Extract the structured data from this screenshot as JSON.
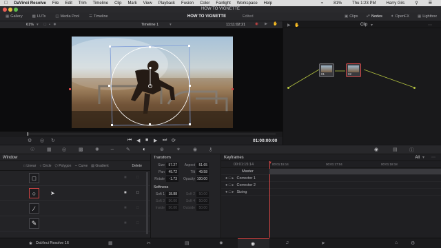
{
  "mac_menu": {
    "app": "DaVinci Resolve",
    "items": [
      "File",
      "Edit",
      "Trim",
      "Timeline",
      "Clip",
      "Mark",
      "View",
      "Playback",
      "Fusion",
      "Color",
      "Fairlight",
      "Workspace",
      "Help"
    ],
    "battery": "81%",
    "clock": "Thu 1:23 PM",
    "user": "Harry Gils"
  },
  "window_title": "HOW TO VIGNETTE",
  "top_toolbar": {
    "gallery": "Gallery",
    "luts": "LUTs",
    "media_pool": "Media Pool",
    "timeline": "Timeline",
    "project_title": "HOW TO VIGNETTE",
    "edited": "Edited",
    "clips": "Clips",
    "nodes": "Nodes",
    "openfx": "OpenFX",
    "lightbox": "Lightbox"
  },
  "viewer_bar": {
    "zoom": "61%",
    "timeline_name": "Timeline 1",
    "timecode": "11:11:02:21",
    "clip_label": "Clip"
  },
  "transport": {
    "timecode": "01:00:00:00"
  },
  "nodes": [
    {
      "label": "01"
    },
    {
      "label": "02"
    }
  ],
  "window_panel": {
    "title": "Window",
    "tools": [
      "Linear",
      "Circle",
      "Polygon",
      "Curve",
      "Gradient"
    ],
    "delete": "Delete"
  },
  "transform": {
    "title": "Transform",
    "rows": [
      {
        "l1": "Size",
        "v1": "57.27",
        "l2": "Aspect",
        "v2": "51.65"
      },
      {
        "l1": "Pan",
        "v1": "49.72",
        "l2": "Tilt",
        "v2": "49.58"
      },
      {
        "l1": "Rotate",
        "v1": "-1.73",
        "l2": "Opacity",
        "v2": "100.00"
      }
    ],
    "softness_title": "Softness",
    "soft_rows": [
      {
        "l1": "Soft 1",
        "v1": "18.88",
        "l2": "Soft 2",
        "v2": "50.00"
      },
      {
        "l1": "Soft 3",
        "v1": "50.00",
        "l2": "Soft 4",
        "v2": "50.00"
      },
      {
        "l1": "Inside",
        "v1": "50.00",
        "l2": "Outside",
        "v2": "50.00"
      }
    ]
  },
  "keyframes": {
    "title": "Keyframes",
    "mode": "All",
    "timecode": "00:01:15:14",
    "ruler": [
      "00:01:15:14",
      "00:01:17:04",
      "00:01:18:18"
    ],
    "tracks": [
      "Master",
      "Corrector 1",
      "Corrector 2",
      "Sizing"
    ]
  },
  "bottom": {
    "app_name": "DaVinci Resolve 16"
  },
  "colors": {
    "accent_red": "#d04545",
    "node_line": "#b5c440",
    "window_outline": "#7d9bd8"
  }
}
